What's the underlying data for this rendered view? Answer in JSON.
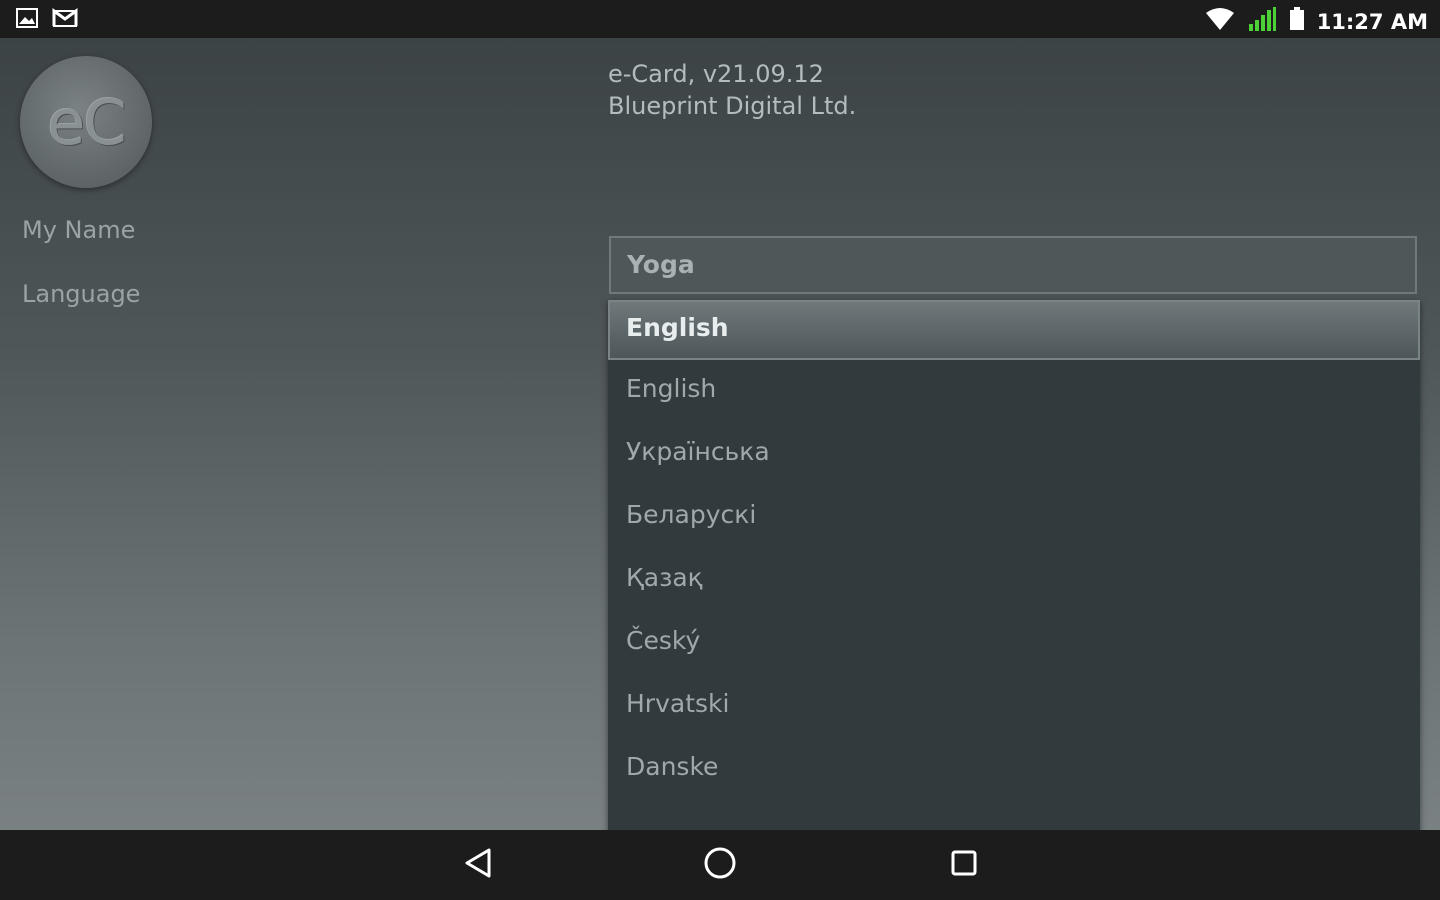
{
  "statusbar": {
    "time": "11:27 AM",
    "icons": [
      "gallery-icon",
      "gmail-icon",
      "wifi-icon",
      "signal-icon",
      "battery-icon"
    ]
  },
  "profile": {
    "avatar_text": "eC",
    "my_name_label": "My Name",
    "language_label": "Language"
  },
  "app_info": {
    "version": "e-Card,  v21.09.12",
    "company": "Blueprint Digital Ltd."
  },
  "name_field": {
    "value": "Yoga"
  },
  "language_select": {
    "selected": "English",
    "options": [
      "English",
      "Українська",
      "Беларускі",
      "Қазақ",
      "Český",
      "Hrvatski",
      "Danske"
    ]
  },
  "navbar": {
    "icons": [
      "back-icon",
      "home-icon",
      "recents-icon"
    ]
  }
}
